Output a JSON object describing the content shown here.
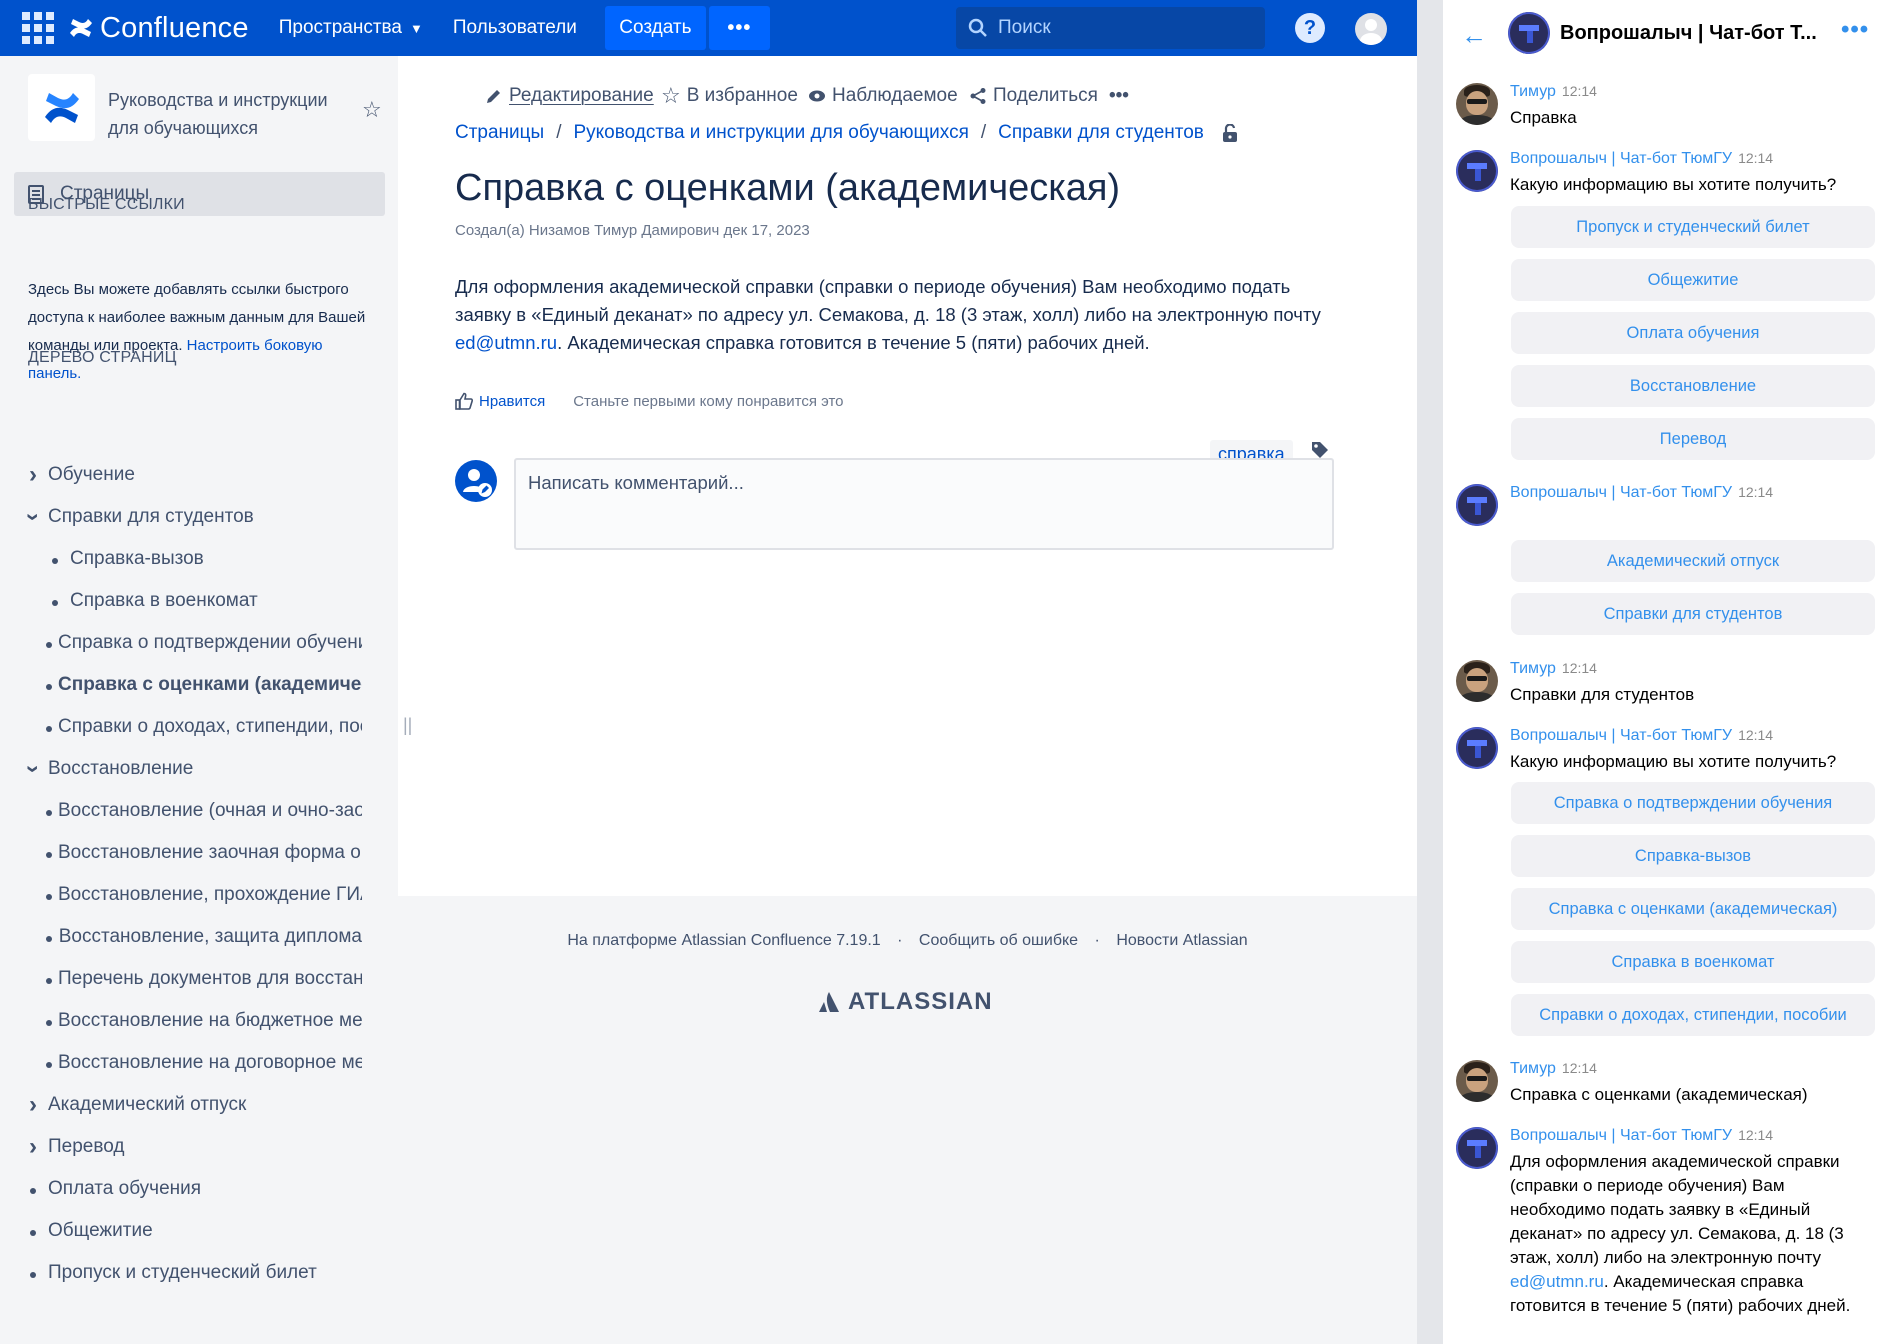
{
  "confluence": {
    "app_name": "Confluence",
    "nav": {
      "spaces": "Пространства",
      "users": "Пользователи",
      "create": "Создать",
      "more": "•••"
    },
    "search_placeholder": "Поиск",
    "help": "?",
    "sidebar": {
      "space_title": "Руководства и инструкции для обучающихся",
      "pages_label": "Страницы",
      "quick_links_title": "БЫСТРЫЕ ССЫЛКИ",
      "quick_links_text": "Здесь Вы можете добавлять ссылки быстрого доступа к наиболее важным данным для Вашей команды или проекта.",
      "quick_links_link": "Настроить боковую панель.",
      "tree_title": "ДЕРЕВО СТРАНИЦ",
      "tree": [
        {
          "label": "Обучение",
          "level": 1,
          "control": "collapsed"
        },
        {
          "label": "Справки для студентов",
          "level": 1,
          "control": "expanded"
        },
        {
          "label": "Справка-вызов",
          "level": 2,
          "control": "bullet"
        },
        {
          "label": "Справка в военкомат",
          "level": 2,
          "control": "bullet"
        },
        {
          "label": "Справка о подтверждении обучения",
          "level": 2,
          "control": "bullet"
        },
        {
          "label": "Справка с оценками (академическая)",
          "level": 2,
          "control": "bullet",
          "active": true
        },
        {
          "label": "Справки о доходах, стипендии, пособии",
          "level": 2,
          "control": "bullet"
        },
        {
          "label": "Восстановление",
          "level": 1,
          "control": "expanded"
        },
        {
          "label": "Восстановление (очная и очно-заочная форма)",
          "level": 2,
          "control": "bullet"
        },
        {
          "label": "Восстановление заочная форма обучения",
          "level": 2,
          "control": "bullet"
        },
        {
          "label": "Восстановление, прохождение ГИА",
          "level": 2,
          "control": "bullet"
        },
        {
          "label": "Восстановление, защита диплома",
          "level": 2,
          "control": "bullet"
        },
        {
          "label": "Перечень документов для восстановления",
          "level": 2,
          "control": "bullet"
        },
        {
          "label": "Восстановление на бюджетное место",
          "level": 2,
          "control": "bullet"
        },
        {
          "label": "Восстановление на договорное место",
          "level": 2,
          "control": "bullet"
        },
        {
          "label": "Академический отпуск",
          "level": 1,
          "control": "collapsed"
        },
        {
          "label": "Перевод",
          "level": 1,
          "control": "collapsed"
        },
        {
          "label": "Оплата обучения",
          "level": 1,
          "control": "bullet"
        },
        {
          "label": "Общежитие",
          "level": 1,
          "control": "bullet"
        },
        {
          "label": "Пропуск и студенческий билет",
          "level": 1,
          "control": "bullet"
        }
      ]
    },
    "actions": {
      "edit": "Редактирование",
      "favorite": "В избранное",
      "watch": "Наблюдаемое",
      "share": "Поделиться",
      "more": "•••"
    },
    "breadcrumbs": [
      "Страницы",
      "Руководства и инструкции для обучающихся",
      "Справки для студентов"
    ],
    "page": {
      "title": "Справка с оценками (академическая)",
      "byline": "Создал(а) Низамов Тимур Дамирович дек 17, 2023",
      "body_before": "Для оформления академической справки (справки о периоде обучения) Вам необходимо подать заявку в «Единый деканат» по адресу ул. Семакова, д. 18 (3 этаж, холл) либо на электронную почту ",
      "body_link": "ed@utmn.ru",
      "body_after": ". Академическая справка готовится в течение 5 (пяти) рабочих дней.",
      "like": "Нравится",
      "like_first": "Станьте первыми кому понравится это",
      "label": "справка",
      "comment_placeholder": "Написать комментарий..."
    },
    "footer": {
      "powered": "На платформе Atlassian Confluence 7.19.1",
      "report": "Сообщить об ошибке",
      "news": "Новости Atlassian",
      "dot": "·",
      "atlassian": "ATLASSIAN"
    }
  },
  "chat": {
    "title": "Вопрошалыч | Чат-бот Т...",
    "messages": [
      {
        "author": "Тимур",
        "time": "12:14",
        "text": "Справка",
        "kind": "user"
      },
      {
        "author": "Вопрошалыч | Чат-бот ТюмГУ",
        "time": "12:14",
        "text": "Какую информацию вы хотите получить?",
        "kind": "bot"
      },
      {
        "author": "Вопрошалыч | Чат-бот ТюмГУ",
        "time": "12:14",
        "text": "",
        "kind": "bot"
      },
      {
        "author": "Тимур",
        "time": "12:14",
        "text": "Справки для студентов",
        "kind": "user"
      },
      {
        "author": "Вопрошалыч | Чат-бот ТюмГУ",
        "time": "12:14",
        "text": "Какую информацию вы хотите получить?",
        "kind": "bot"
      },
      {
        "author": "Тимур",
        "time": "12:14",
        "text": "Справка с оценками (академическая)",
        "kind": "user"
      },
      {
        "author": "Вопрошалыч | Чат-бот ТюмГУ",
        "time": "12:14",
        "text_before": "Для оформления академической справки (справки о периоде обучения) Вам необходимо подать заявку в «Единый деканат» по адресу ул. Семакова, д. 18 (3 этаж, холл) либо на электронную почту ",
        "link": "ed@utmn.ru",
        "text_after": ". Академическая справка готовится в течение 5 (пяти) рабочих дней.",
        "kind": "bot"
      }
    ],
    "keyboard1": [
      "Пропуск и студенческий билет",
      "Общежитие",
      "Оплата обучения",
      "Восстановление",
      "Перевод"
    ],
    "keyboard2": [
      "Академический отпуск",
      "Справки для студентов"
    ],
    "keyboard3": [
      "Справка о подтверждении обучения",
      "Справка-вызов",
      "Справка с оценками (академическая)",
      "Справка в военкомат",
      "Справки о доходах, стипендии, пособии"
    ]
  },
  "colors": {
    "confluence_blue": "#0052cc",
    "telegram_blue": "#3390ec"
  }
}
